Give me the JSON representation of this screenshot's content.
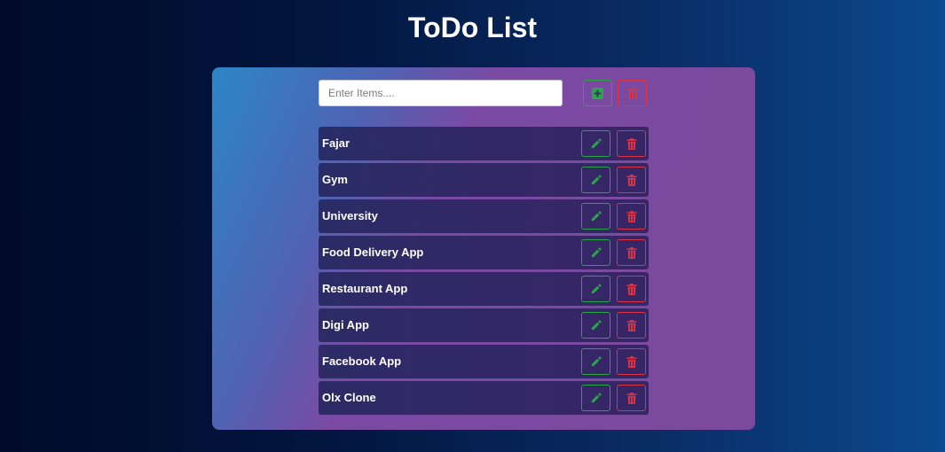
{
  "app": {
    "title": "ToDo List"
  },
  "input": {
    "placeholder": "Enter Items....",
    "value": ""
  },
  "buttons": {
    "add_icon": "plus-square-icon",
    "clear_icon": "trash-icon",
    "edit_icon": "pencil-icon",
    "delete_icon": "trash-icon"
  },
  "colors": {
    "accent_green": "#28a745",
    "accent_red": "#dc3545"
  },
  "todos": [
    {
      "label": "Fajar"
    },
    {
      "label": "Gym"
    },
    {
      "label": "University"
    },
    {
      "label": "Food Delivery App"
    },
    {
      "label": "Restaurant App"
    },
    {
      "label": "Digi App"
    },
    {
      "label": "Facebook App"
    },
    {
      "label": "Olx Clone"
    }
  ]
}
